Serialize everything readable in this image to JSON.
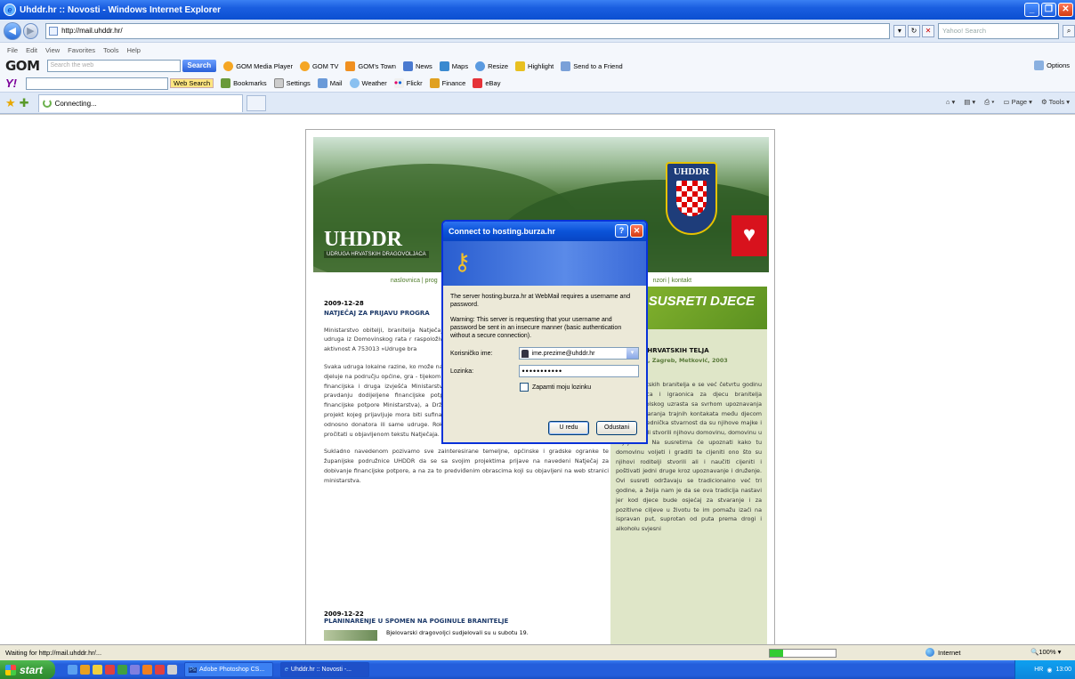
{
  "window": {
    "title": "Uhddr.hr :: Novosti - Windows Internet Explorer"
  },
  "address": {
    "url": "http://mail.uhddr.hr/",
    "search_placeholder": "Yahoo! Search"
  },
  "menu": [
    "File",
    "Edit",
    "View",
    "Favorites",
    "Tools",
    "Help"
  ],
  "gom_toolbar": {
    "logo": "GOM",
    "search_placeholder": "Search the web",
    "search_button": "Search",
    "items": [
      "GOM Media Player",
      "GOM TV",
      "GOM's Town",
      "News",
      "Maps",
      "Resize",
      "Highlight",
      "Send to a Friend"
    ],
    "options": "Options"
  },
  "yahoo_toolbar": {
    "logo": "Y!",
    "web_search": "Web Search",
    "items": [
      "Bookmarks",
      "Settings",
      "Mail",
      "Weather",
      "Flickr",
      "Finance",
      "eBay"
    ]
  },
  "tab": {
    "label": "Connecting..."
  },
  "tab_tools": [
    "Page",
    "Tools"
  ],
  "site": {
    "brand": "UHDDR",
    "brand_sub": "UDRUGA HRVATSKIH DRAGOVOLJACA",
    "crest_text": "UHDDR",
    "nav_left": "naslovnica | prog",
    "nav_right": "nzori | kontakt",
    "news1": {
      "date": "2009-12-28",
      "title": "NATJEČAJ ZA PRIJAVU PROGRA",
      "p1": "Ministarstvo obitelji, branitelja Natječaj objavljen u Vjesniku stranicama ministarstva www.m udruga iz Domovinskog rata r raspoloživih sredstava Državnog za razdjel 046 Ministarstvo obitel aktivnost A 753013 »Udruge bra",
      "p2": "Svaka udruga lokalne razine, ko može na ovaj natječaj prijaviti s godini. Udruga mora ispunjavati - djeluje na području općine, gra - tijekom 2008. i 2009. godine uredno i na vrijeme predala je svoja financijska i druga izvješća Ministarstvu obitelji, branitelja i međugeneracijske solidarnosti o pravdanju dodijeljene financijske potpore na ime odobrenih programa/projekata (korisnici financijske potpore Ministarstva), a Državnom uredu za reviziju u zakonom utvrđenom roku. - projekt kojeg prijavljuje mora biti sufinanciran od strane jedinice lokalne uprave ili samouprave, odnosno donatora ili same udruge. Rok Natječaja je 30 dana od objave, a uvjete je potrebno pročitati u objavljenom tekstu Natječaja.",
      "p3": "Sukladno navedenom pozivamo sve zainteresirane temeljne, općinske i gradske ogranke te županijske podružnice UHDDR da se sa svojim projektima prijave na navedeni Natječaj za dobivanje financijske potpore, a na za to predviđenim obrascima koji su objavljeni na web stranici ministarstva."
    },
    "news2": {
      "date": "2009-12-22",
      "title": "PLANINARENJE U SPOMEN NA POGINULE BRANITELJE",
      "snippet": "Bjelovarski dragovoljci sudjelovali su u subotu 19."
    },
    "side": {
      "banner": "SUSRETI DJECE",
      "heading": "m",
      "subtitle": "TI DJECE HRVATSKIH TELJA",
      "places": ", Varaždin, Zagreb, Metković, 2003",
      "label": "pis:",
      "body": "djece hrvatskih branitelja e se već četvrtu godinu kao dionica i igraonica za djecu branitelja osnovnoškolskog uzrasta sa svrhom upoznavanja djece i stvaranja trajnih kontakata među djecom kojoj je zajednička stvarnost da su njihove majke i očevi branili stvorili njihovu domovinu, domovinu u kojoj žive. Na susretima će upoznati kako tu domovinu voljeti i graditi te cijeniti ono što su njihovi roditelji stvorili ali i naučiti cijeniti i poštivati jedni druge kroz upoznavanje i druženje. Ovi susreti održavaju se tradicionalno već tri godine, a želja nam je da se ova tradicija nastavi jer kod djece bude osjećaj za stvaranje i za pozitivne ciljeve u životu te im pomažu izaći na ispravan put, suprotan od puta prema drogi i alkoholu svjesni"
    }
  },
  "dialog": {
    "title": "Connect to hosting.burza.hr",
    "text1": "The server hosting.burza.hr at WebMail requires a username and password.",
    "text2": "Warning: This server is requesting that your username and password be sent in an insecure manner (basic authentication without a secure connection).",
    "username_label": "Korisničko ime:",
    "username_value": "ime.prezime@uhddr.hr",
    "password_label": "Lozinka:",
    "password_value": "•••••••••••",
    "remember_label": "Zapamti moju lozinku",
    "ok": "U redu",
    "cancel": "Odustani"
  },
  "status": {
    "text": "Waiting for http://mail.uhddr.hr/...",
    "zone": "Internet",
    "zoom": "100%",
    "progress": 0.2
  },
  "taskbar": {
    "start": "start",
    "items": [
      "Adobe Photoshop CS...",
      "Uhddr.hr :: Novosti -..."
    ],
    "tray_lang": "HR",
    "clock": "13:00"
  },
  "colors": {
    "accent": "#0b4fd1",
    "site_green": "#5a9020",
    "heart_red": "#d8121d"
  }
}
